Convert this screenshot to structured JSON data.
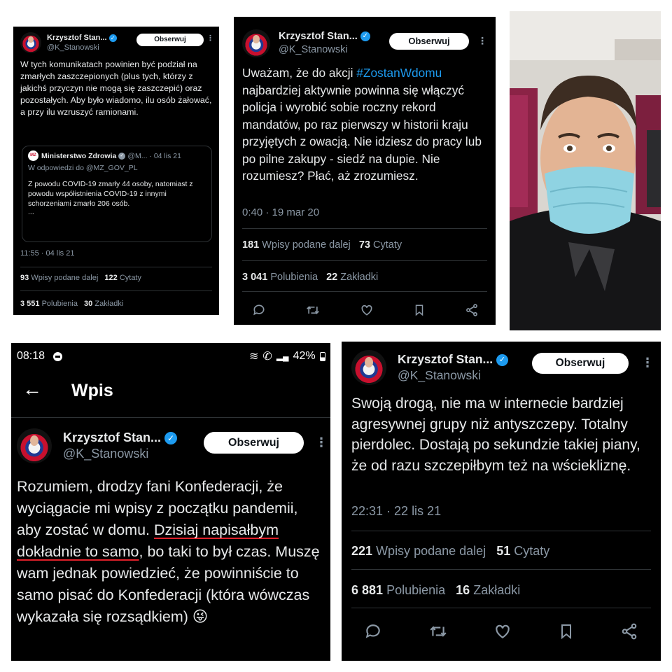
{
  "panel1": {
    "name": "Krzysztof Stan...",
    "handle": "@K_Stanowski",
    "follow": "Obserwuj",
    "text": "W tych komunikatach powinien być podział na zmarłych zaszczepionych (plus tych, którzy z jakichś przyczyn nie mogą się zaszczepić) oraz pozostałych. Aby było wiadomo, ilu osób żałować, a przy ilu wzruszyć ramionami.",
    "quote": {
      "logo": "MZ",
      "name": "Ministerstwo Zdrowia",
      "handle_date": "@M... · 04 lis 21",
      "reply_to": "W odpowiedzi do @MZ_GOV_PL",
      "text": "Z powodu COVID-19 zmarły 44 osoby, natomiast z powodu współistnienia COVID-19 z innymi schorzeniami zmarło 206 osób.",
      "ellipsis": "..."
    },
    "time": "11:55 · 04 lis 21",
    "reposts_n": "93",
    "reposts_l": "Wpisy podane dalej",
    "quotes_n": "122",
    "quotes_l": "Cytaty",
    "likes_n": "3 551",
    "likes_l": "Polubienia",
    "bookmarks_n": "30",
    "bookmarks_l": "Zakładki"
  },
  "panel2": {
    "name": "Krzysztof Stan...",
    "handle": "@K_Stanowski",
    "follow": "Obserwuj",
    "text_a": "Uważam, że do akcji ",
    "hashtag": "#ZostanWdomu",
    "text_b": " najbardziej aktywnie powinna się włączyć policja i wyrobić sobie roczny rekord mandatów, po raz pierwszy w historii kraju przyjętych z owacją. Nie idziesz do pracy lub po pilne zakupy - siedź na dupie. Nie rozumiesz? Płać, aż zrozumiesz.",
    "time": "0:40 · 19 mar 20",
    "reposts_n": "181",
    "reposts_l": "Wpisy podane dalej",
    "quotes_n": "73",
    "quotes_l": "Cytaty",
    "likes_n": "3 041",
    "likes_l": "Polubienia",
    "bookmarks_n": "22",
    "bookmarks_l": "Zakładki"
  },
  "panel3": {
    "status_time": "08:18",
    "battery": "42%",
    "title": "Wpis",
    "name": "Krzysztof Stan...",
    "handle": "@K_Stanowski",
    "follow": "Obserwuj",
    "text_a": "Rozumiem, drodzy fani Konfederacji, że wyciągacie mi wpisy z początku pandemii, aby zostać w domu. ",
    "text_u": "Dzisiaj napisałbym dokładnie to samo",
    "text_b": ", bo taki to był czas. Muszę wam jednak powiedzieć, że powinniście to samo pisać do Konfederacji (która wówczas wykazała się rozsądkiem) 😜"
  },
  "panel4": {
    "name": "Krzysztof Stan...",
    "handle": "@K_Stanowski",
    "follow": "Obserwuj",
    "text": "Swoją drogą, nie ma w internecie bardziej agresywnej grupy niż antyszczepy. Totalny pierdolec. Dostają po sekundzie takiej piany, że od razu szczepiłbym też na wściekliznę.",
    "time": "22:31 · 22 lis 21",
    "reposts_n": "221",
    "reposts_l": "Wpisy podane dalej",
    "quotes_n": "51",
    "quotes_l": "Cytaty",
    "likes_n": "6 881",
    "likes_l": "Polubienia",
    "bookmarks_n": "16",
    "bookmarks_l": "Zakładki"
  },
  "colors": {
    "accent": "#1d9bf0",
    "background": "#000000",
    "muted": "#8b98a5",
    "underline": "#e0202a"
  },
  "icons": [
    "reply-icon",
    "repost-icon",
    "like-icon",
    "bookmark-icon",
    "share-icon",
    "back-arrow-icon",
    "verified-icon",
    "more-icon",
    "wifi-icon",
    "signal-icon",
    "battery-icon"
  ]
}
